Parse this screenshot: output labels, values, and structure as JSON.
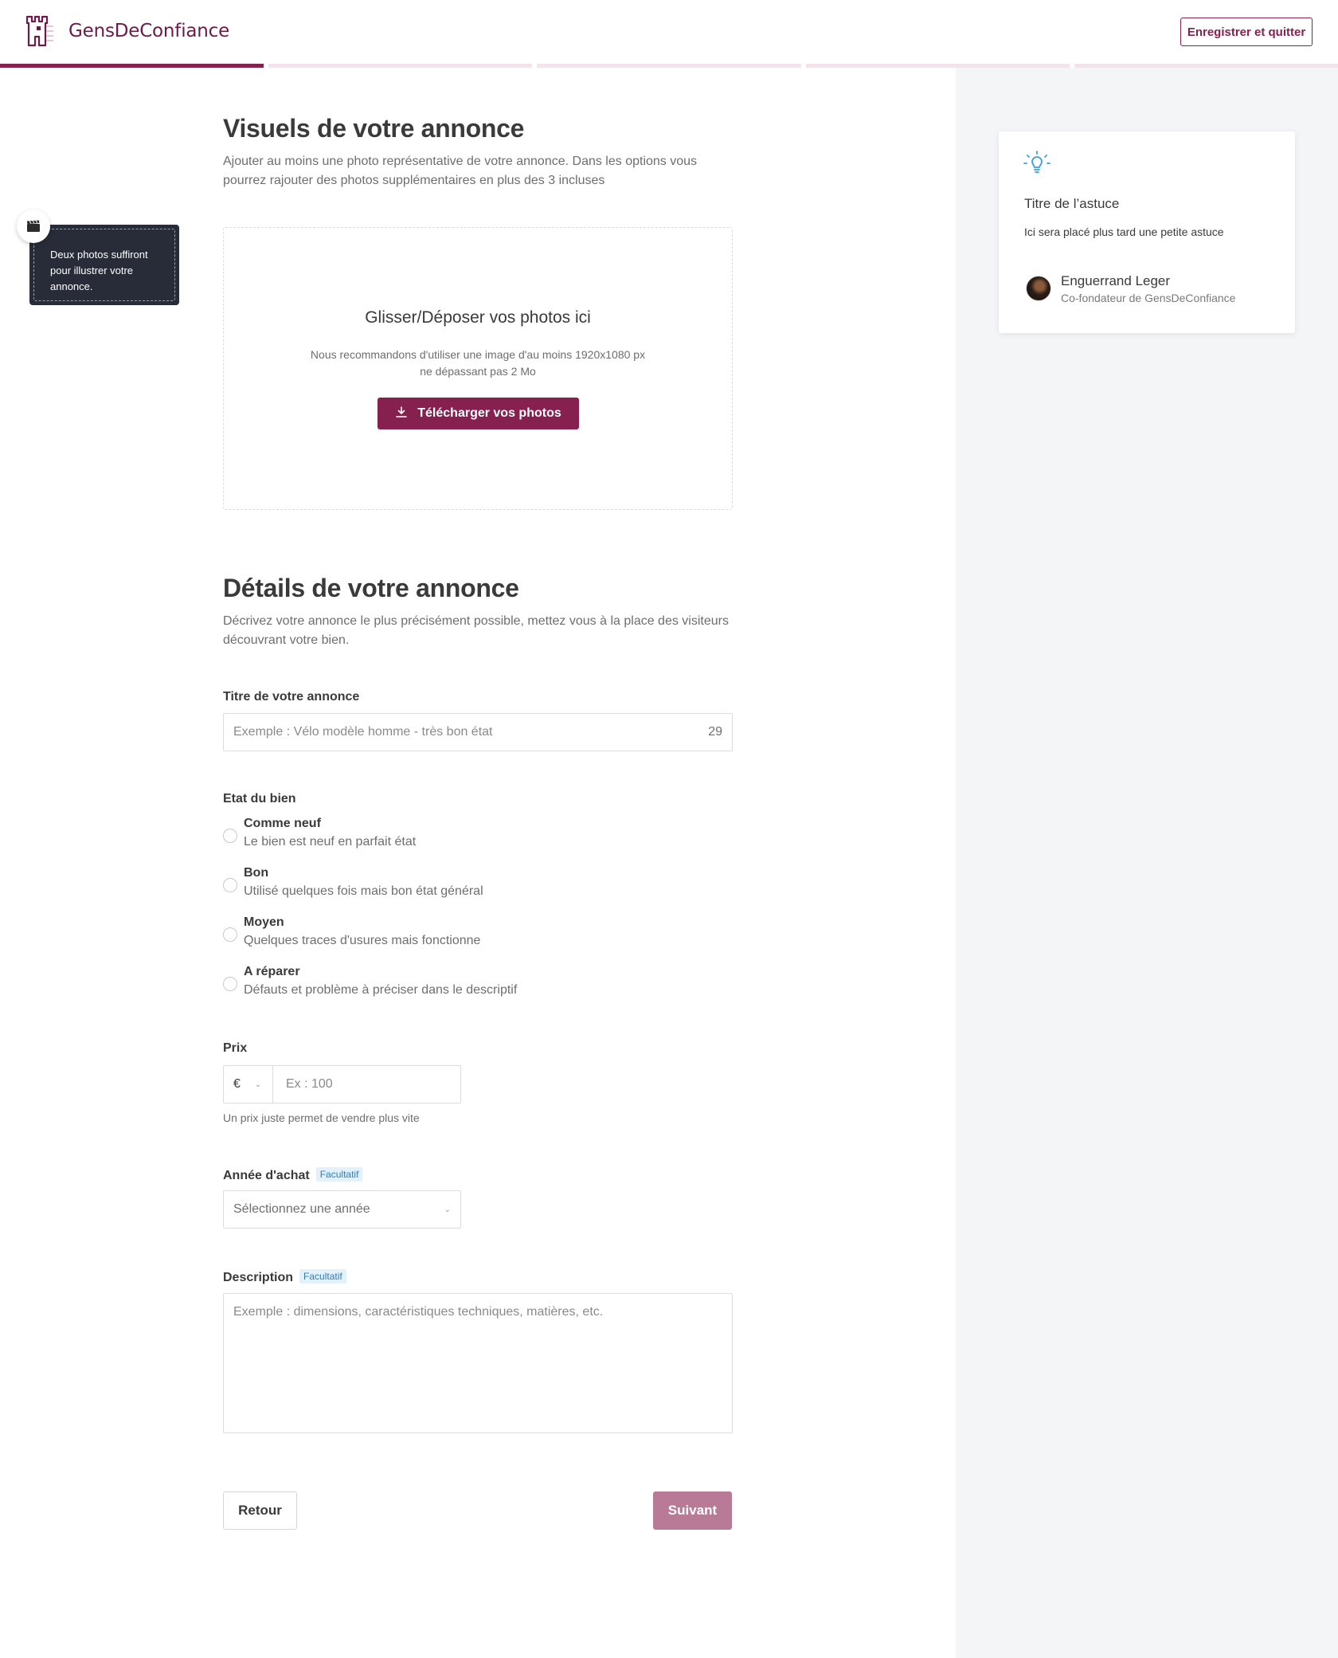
{
  "header": {
    "brand": "GensDeConfiance",
    "save_quit_label": "Enregistrer et quitter",
    "progress": {
      "total_steps": 5,
      "current_step": 1
    }
  },
  "colors": {
    "brand": "#86204f",
    "brand_disabled": "#b97a98",
    "hint_bg": "#272c38",
    "badge_text": "#2f7fb5",
    "tip_icon": "#3aa0e0"
  },
  "hint": {
    "icon": "clapperboard-icon",
    "text": "Deux photos suffiront pour illustrer votre annonce."
  },
  "visuals": {
    "title": "Visuels de votre annonce",
    "subtitle": "Ajouter au moins une photo représentative de votre annonce. Dans les options vous pourrez rajouter des photos supplémentaires en plus des 3 incluses",
    "drop_title": "Glisser/Déposer vos photos ici",
    "drop_text_line1": "Nous recommandons d'utiliser une image d'au moins 1920x1080 px",
    "drop_text_line2": "ne dépassant pas 2 Mo",
    "upload_label": "Télécharger vos photos",
    "upload_icon": "download-icon"
  },
  "details": {
    "title": "Détails de votre annonce",
    "subtitle": "Décrivez votre annonce le plus précisément possible, mettez vous à la place des visiteurs découvrant votre bien.",
    "listing_title": {
      "label": "Titre de votre annonce",
      "placeholder": "Exemple : Vélo modèle homme - très bon état",
      "char_count": "29"
    },
    "condition": {
      "label": "Etat du bien",
      "options": [
        {
          "title": "Comme neuf",
          "desc": "Le bien est neuf en parfait état"
        },
        {
          "title": "Bon",
          "desc": "Utilisé quelques fois mais bon état général"
        },
        {
          "title": "Moyen",
          "desc": "Quelques traces d'usures mais fonctionne"
        },
        {
          "title": "A réparer",
          "desc": "Défauts et problème à préciser dans le descriptif"
        }
      ]
    },
    "price": {
      "label": "Prix",
      "currency": "€",
      "placeholder": "Ex : 100",
      "help": "Un prix juste permet de vendre plus vite"
    },
    "year": {
      "label": "Année d'achat",
      "badge": "Facultatif",
      "placeholder": "Sélectionnez une année"
    },
    "description": {
      "label": "Description",
      "badge": "Facultatif",
      "placeholder": "Exemple : dimensions, caractéristiques techniques, matières, etc."
    }
  },
  "footer": {
    "back_label": "Retour",
    "next_label": "Suivant"
  },
  "tip": {
    "icon": "lightbulb-icon",
    "title": "Titre de l’astuce",
    "text": "Ici sera placé plus tard une petite astuce",
    "author_name": "Enguerrand Leger",
    "author_role": "Co-fondateur de GensDeConfiance"
  }
}
